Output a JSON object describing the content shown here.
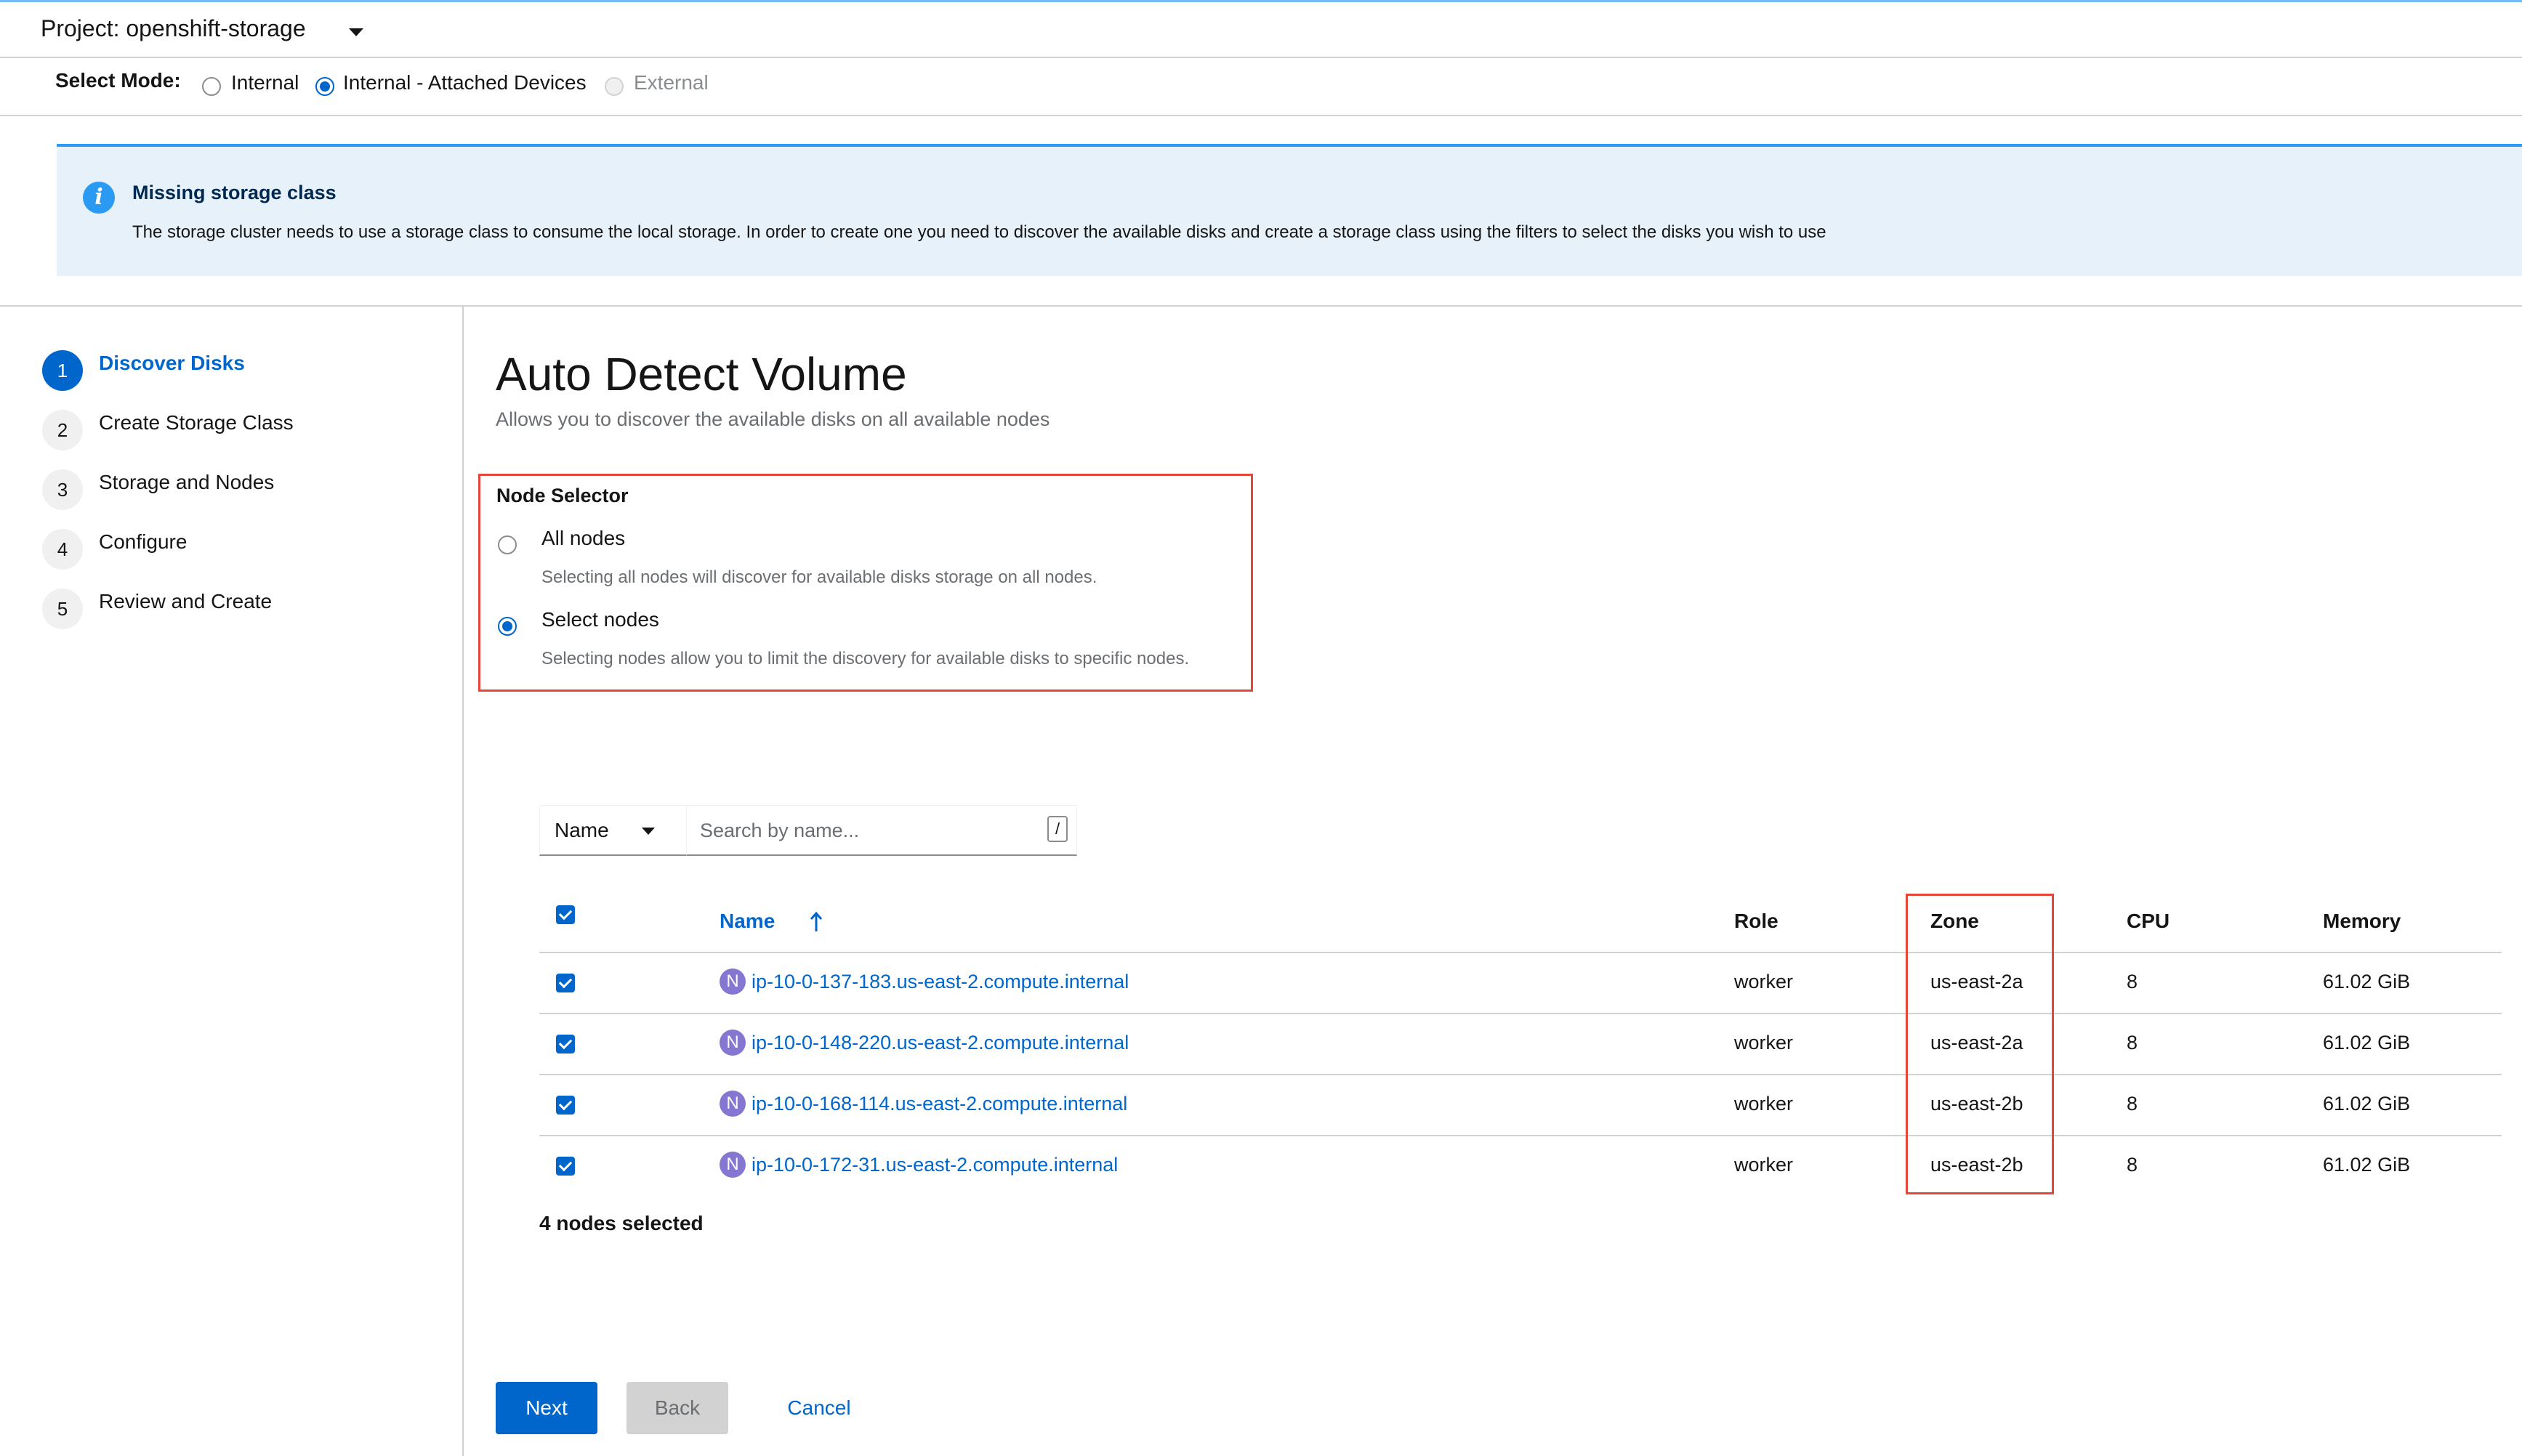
{
  "project": {
    "label": "Project: openshift-storage"
  },
  "mode": {
    "label": "Select Mode:",
    "options": [
      {
        "label": "Internal",
        "selected": false,
        "disabled": false
      },
      {
        "label": "Internal - Attached Devices",
        "selected": true,
        "disabled": false
      },
      {
        "label": "External",
        "selected": false,
        "disabled": true
      }
    ]
  },
  "alert": {
    "icon": "info-icon",
    "title": "Missing storage class",
    "body": "The storage cluster needs to use a storage class to consume the local storage. In order to create one you need to discover the available disks and create a storage class using the filters to select the disks you wish to use"
  },
  "wizard": {
    "steps": [
      {
        "num": "1",
        "label": "Discover Disks",
        "active": true
      },
      {
        "num": "2",
        "label": "Create Storage Class",
        "active": false
      },
      {
        "num": "3",
        "label": "Storage and Nodes",
        "active": false
      },
      {
        "num": "4",
        "label": "Configure",
        "active": false
      },
      {
        "num": "5",
        "label": "Review and Create",
        "active": false
      }
    ]
  },
  "main": {
    "title": "Auto Detect Volume",
    "subtitle": "Allows you to discover the available disks on all available nodes",
    "node_selector": {
      "title": "Node Selector",
      "options": [
        {
          "label": "All nodes",
          "description": "Selecting all nodes will discover for available disks storage on all nodes.",
          "selected": false
        },
        {
          "label": "Select nodes",
          "description": "Selecting nodes allow you to limit the discovery for available disks to specific nodes.",
          "selected": true
        }
      ]
    }
  },
  "filter": {
    "select_label": "Name",
    "search_placeholder": "Search by name...",
    "shortcut": "/"
  },
  "table": {
    "headers": {
      "name": "Name",
      "role": "Role",
      "zone": "Zone",
      "cpu": "CPU",
      "memory": "Memory"
    },
    "sort_icon": "arrow-up-icon",
    "rows": [
      {
        "badge": "N",
        "name": "ip-10-0-137-183.us-east-2.compute.internal",
        "role": "worker",
        "zone": "us-east-2a",
        "cpu": "8",
        "memory": "61.02 GiB",
        "checked": true
      },
      {
        "badge": "N",
        "name": "ip-10-0-148-220.us-east-2.compute.internal",
        "role": "worker",
        "zone": "us-east-2a",
        "cpu": "8",
        "memory": "61.02 GiB",
        "checked": true
      },
      {
        "badge": "N",
        "name": "ip-10-0-168-114.us-east-2.compute.internal",
        "role": "worker",
        "zone": "us-east-2b",
        "cpu": "8",
        "memory": "61.02 GiB",
        "checked": true
      },
      {
        "badge": "N",
        "name": "ip-10-0-172-31.us-east-2.compute.internal",
        "role": "worker",
        "zone": "us-east-2b",
        "cpu": "8",
        "memory": "61.02 GiB",
        "checked": true
      }
    ],
    "selected_count": "4 nodes selected"
  },
  "footer": {
    "next": "Next",
    "back": "Back",
    "cancel": "Cancel"
  },
  "colors": {
    "primary": "#0066cc",
    "alert_bg": "#e7f1fa",
    "alert_border": "#2b9af3",
    "highlight": "#e4473a",
    "node_badge": "#8476d1"
  }
}
